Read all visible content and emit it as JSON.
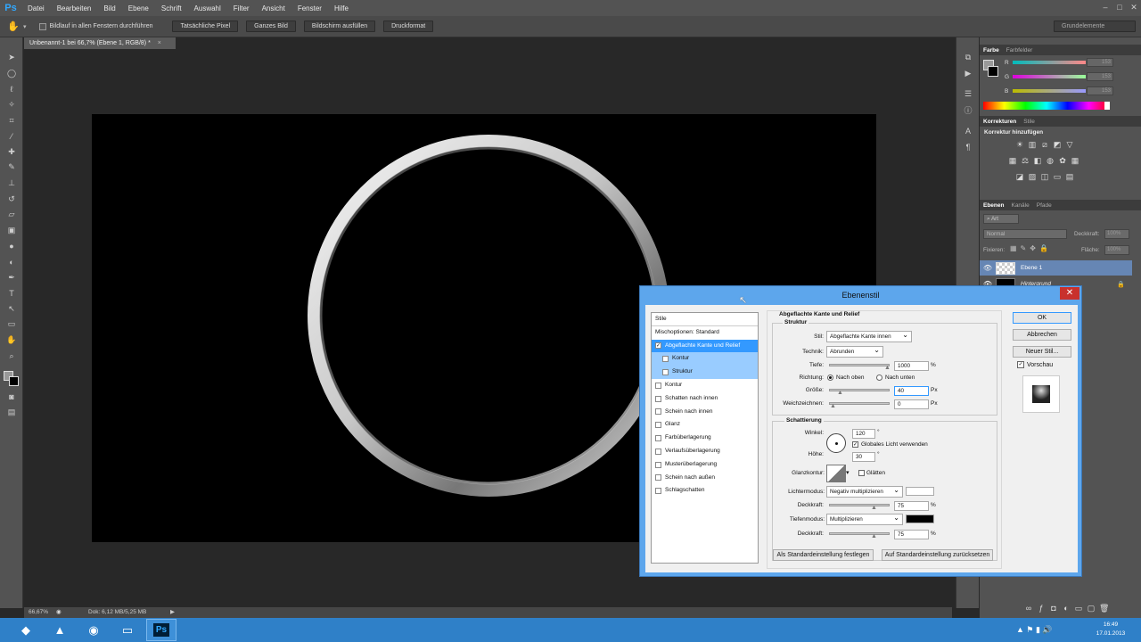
{
  "app": {
    "logo": "Ps"
  },
  "menu": [
    "Datei",
    "Bearbeiten",
    "Bild",
    "Ebene",
    "Schrift",
    "Auswahl",
    "Filter",
    "Ansicht",
    "Fenster",
    "Hilfe"
  ],
  "options": {
    "scroll_all_label": "Bildlauf in allen Fenstern durchführen",
    "buttons": [
      "Tatsächliche Pixel",
      "Ganzes Bild",
      "Bildschirm ausfüllen",
      "Druckformat"
    ],
    "workspace": "Grundelemente"
  },
  "document": {
    "tab_title": "Unbenannt-1 bei 66,7% (Ebene 1, RGB/8) *",
    "zoom": "66,67%",
    "doc_size": "Dok: 6,12 MB/5,25 MB"
  },
  "color_panel": {
    "tabs": [
      "Farbe",
      "Farbfelder"
    ],
    "channels": [
      {
        "label": "R",
        "value": "153"
      },
      {
        "label": "G",
        "value": "153"
      },
      {
        "label": "B",
        "value": "153"
      }
    ]
  },
  "adjust_panel": {
    "tabs": [
      "Korrekturen",
      "Stile"
    ],
    "heading": "Korrektur hinzufügen"
  },
  "layers_panel": {
    "tabs": [
      "Ebenen",
      "Kanäle",
      "Pfade"
    ],
    "filter": "Art",
    "blend_mode": "Normal",
    "opacity_label": "Deckkraft:",
    "opacity_value": "100%",
    "lock_label": "Fixieren:",
    "fill_label": "Fläche:",
    "fill_value": "100%",
    "layers": [
      {
        "name": "Ebene 1"
      },
      {
        "name": "Hintergrund"
      }
    ]
  },
  "dialog": {
    "title": "Ebenenstil",
    "styles_header": "Stile",
    "blend_options": "Mischoptionen: Standard",
    "style_items": [
      {
        "label": "Abgeflachte Kante und Relief",
        "checked": true
      },
      {
        "label": "Kontur",
        "checked": false
      },
      {
        "label": "Struktur",
        "checked": false
      },
      {
        "label": "Kontur",
        "checked": false
      },
      {
        "label": "Schatten nach innen",
        "checked": false
      },
      {
        "label": "Schein nach innen",
        "checked": false
      },
      {
        "label": "Glanz",
        "checked": false
      },
      {
        "label": "Farbüberlagerung",
        "checked": false
      },
      {
        "label": "Verlaufsüberlagerung",
        "checked": false
      },
      {
        "label": "Musterüberlagerung",
        "checked": false
      },
      {
        "label": "Schein nach außen",
        "checked": false
      },
      {
        "label": "Schlagschatten",
        "checked": false
      }
    ],
    "section_title": "Abgeflachte Kante und Relief",
    "structure": {
      "legend": "Struktur",
      "style_label": "Stil:",
      "style_value": "Abgeflachte Kante innen",
      "technique_label": "Technik:",
      "technique_value": "Abrunden",
      "depth_label": "Tiefe:",
      "depth_value": "1000",
      "depth_unit": "%",
      "direction_label": "Richtung:",
      "direction_up": "Nach oben",
      "direction_down": "Nach unten",
      "size_label": "Größe:",
      "size_value": "40",
      "size_unit": "Px",
      "soften_label": "Weichzeichnen:",
      "soften_value": "0",
      "soften_unit": "Px"
    },
    "shading": {
      "legend": "Schattierung",
      "angle_label": "Winkel:",
      "angle_value": "120",
      "angle_unit": "°",
      "global_light": "Globales Licht verwenden",
      "altitude_label": "Höhe:",
      "altitude_value": "30",
      "altitude_unit": "°",
      "gloss_label": "Glanzkontur:",
      "antialias": "Glätten",
      "highlight_label": "Lichtermodus:",
      "highlight_value": "Negativ multiplizieren",
      "highlight_color": "#ffffff",
      "opacity1_label": "Deckkraft:",
      "opacity1_value": "75",
      "opacity1_unit": "%",
      "shadow_label": "Tiefenmodus:",
      "shadow_value": "Multiplizieren",
      "shadow_color": "#000000",
      "opacity2_label": "Deckkraft:",
      "opacity2_value": "75",
      "opacity2_unit": "%"
    },
    "btn_set_default": "Als Standardeinstellung festlegen",
    "btn_reset_default": "Auf Standardeinstellung zurücksetzen",
    "btn_ok": "OK",
    "btn_cancel": "Abbrechen",
    "btn_new_style": "Neuer Stil...",
    "preview_label": "Vorschau"
  },
  "taskbar": {
    "time": "16:49",
    "date": "17.01.2013"
  }
}
